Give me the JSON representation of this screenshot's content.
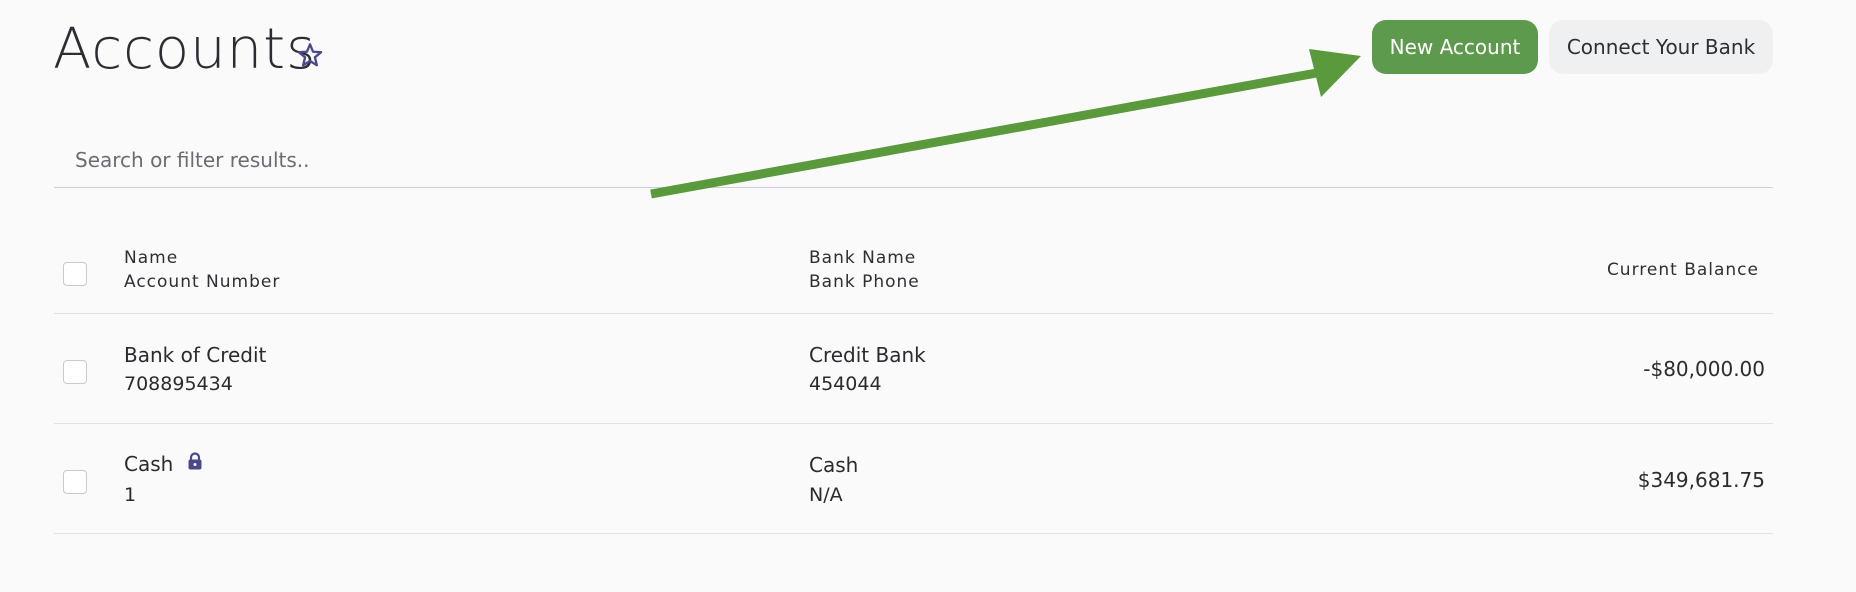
{
  "page": {
    "title": "Accounts",
    "favorite_icon": "star-outline-icon"
  },
  "toolbar": {
    "new_account_label": "New Account",
    "connect_bank_label": "Connect Your Bank"
  },
  "search": {
    "placeholder": "Search or filter results..",
    "value": ""
  },
  "annotation": {
    "arrow_color": "#5a9a3c",
    "arrow_icon": "arrow-pointer-icon"
  },
  "table": {
    "headers": {
      "name": "Name",
      "account_number": "Account Number",
      "bank_name": "Bank Name",
      "bank_phone": "Bank Phone",
      "current_balance": "Current Balance"
    },
    "rows": [
      {
        "name": "Bank of Credit",
        "account_number": "708895434",
        "bank_name": "Credit Bank",
        "bank_phone": "454044",
        "balance": "-$80,000.00",
        "locked": false
      },
      {
        "name": "Cash",
        "account_number": "1",
        "bank_name": "Cash",
        "bank_phone": "N/A",
        "balance": "$349,681.75",
        "locked": true
      }
    ]
  },
  "colors": {
    "primary_button": "#5e9a4e",
    "secondary_button": "#eef0f2",
    "icon_accent": "#4a4a8a",
    "background": "#fafafa"
  }
}
